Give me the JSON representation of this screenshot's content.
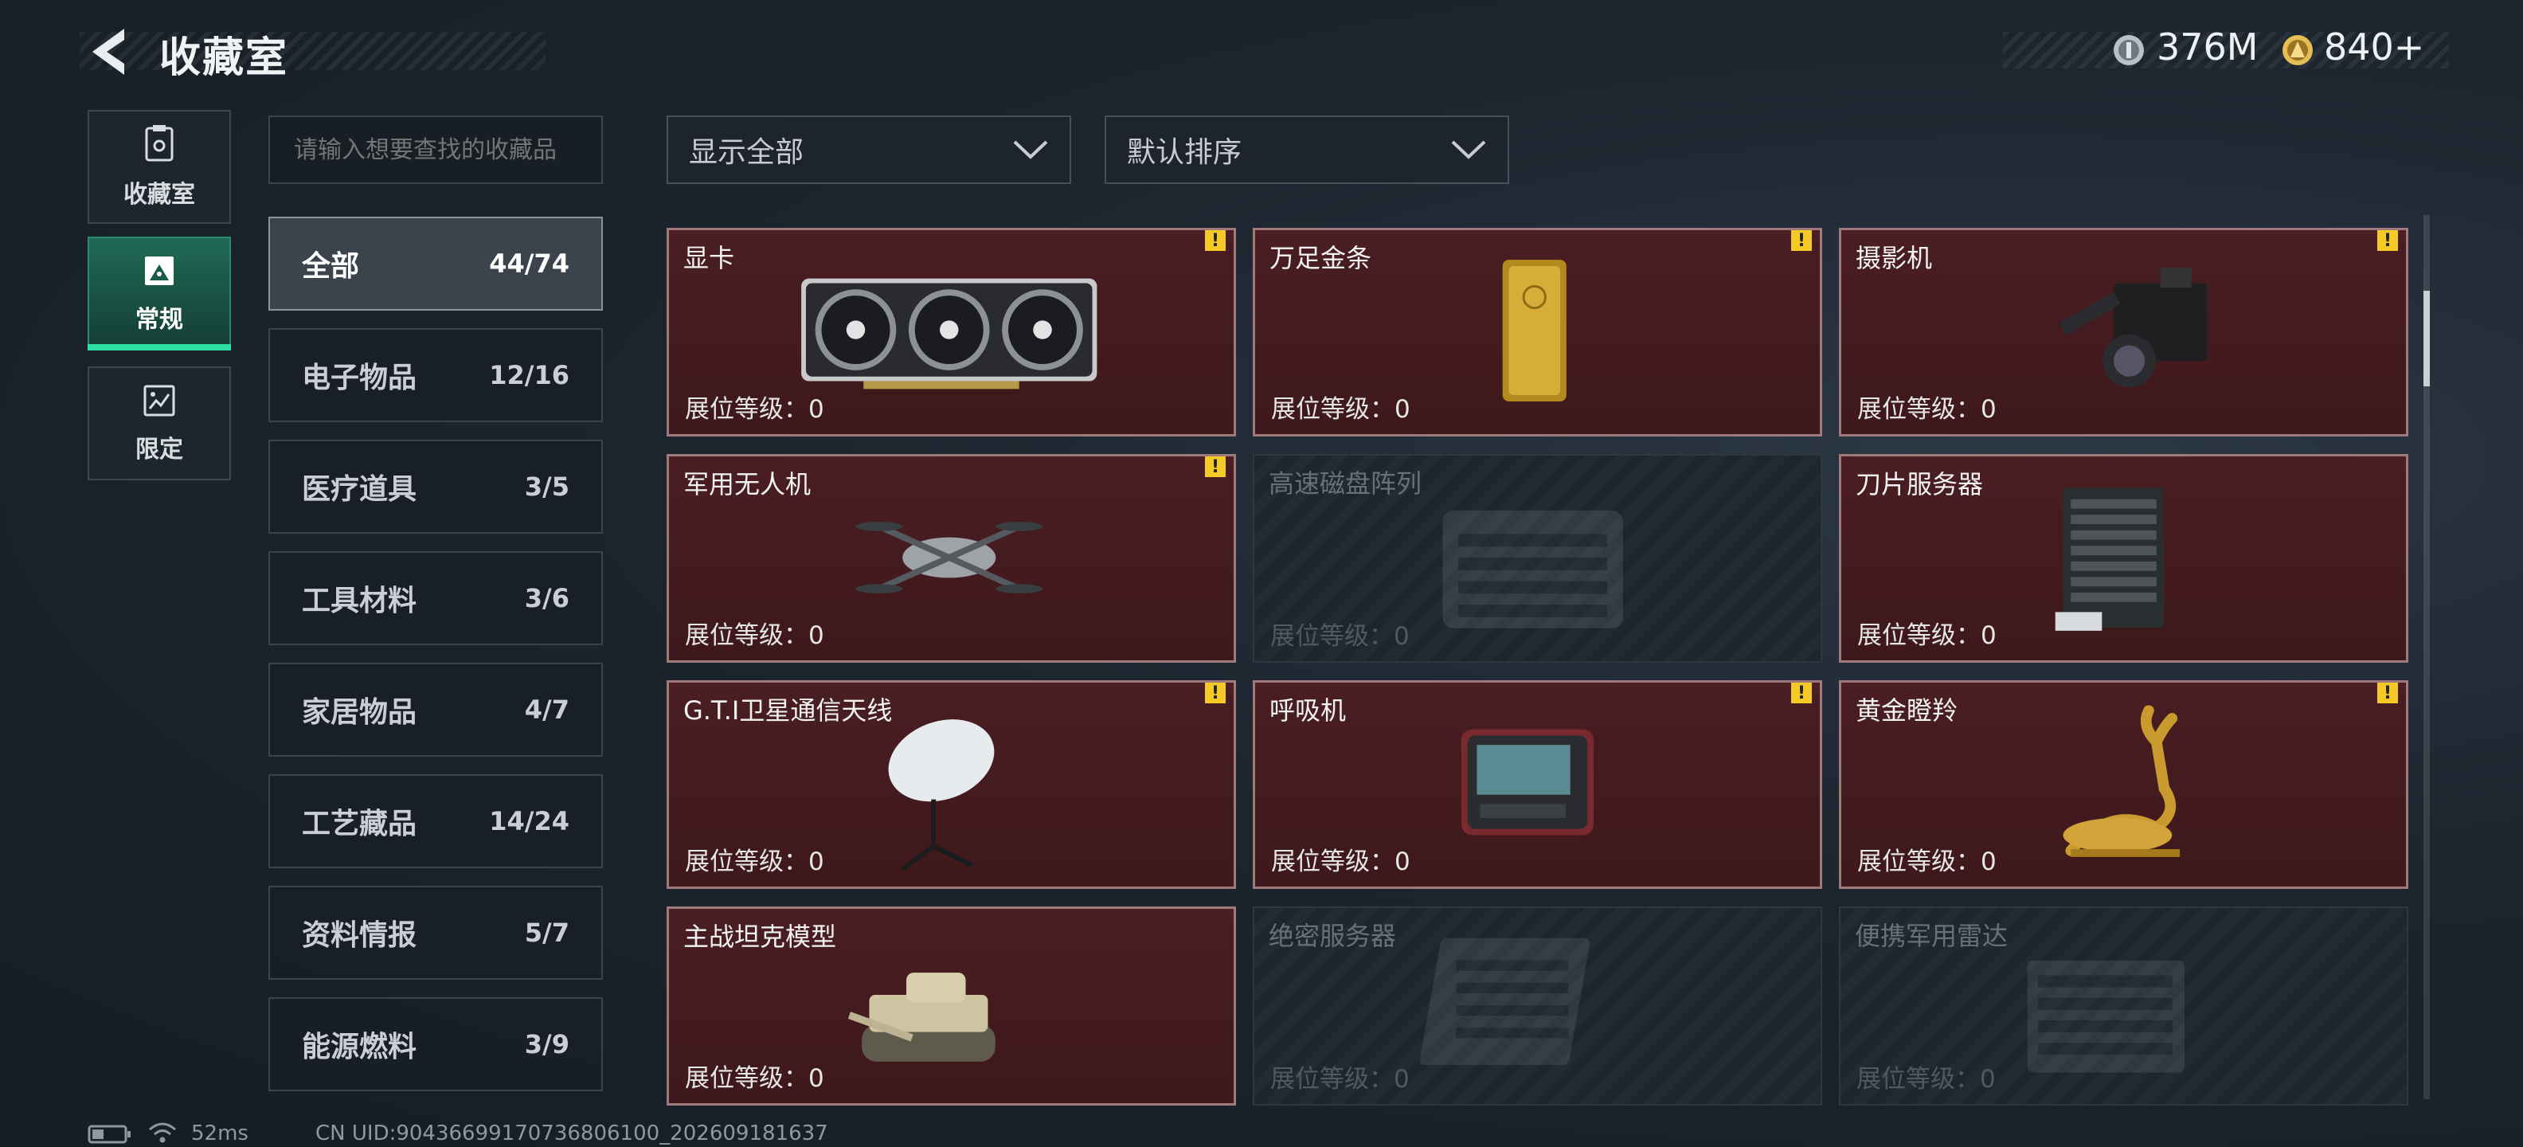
{
  "header": {
    "title": "收藏室",
    "currency": [
      {
        "icon": "silver-coin-icon",
        "value": "376M"
      },
      {
        "icon": "gold-coin-icon",
        "value": "840+"
      }
    ]
  },
  "nav": [
    {
      "label": "收藏室",
      "icon": "collection-room-icon",
      "active": false
    },
    {
      "label": "常规",
      "icon": "regular-items-icon",
      "active": true
    },
    {
      "label": "限定",
      "icon": "limited-items-icon",
      "active": false
    }
  ],
  "search": {
    "placeholder": "请输入想要查找的收藏品"
  },
  "categories": [
    {
      "name": "全部",
      "count": "44/74",
      "active": true
    },
    {
      "name": "电子物品",
      "count": "12/16",
      "active": false
    },
    {
      "name": "医疗道具",
      "count": "3/5",
      "active": false
    },
    {
      "name": "工具材料",
      "count": "3/6",
      "active": false
    },
    {
      "name": "家居物品",
      "count": "4/7",
      "active": false
    },
    {
      "name": "工艺藏品",
      "count": "14/24",
      "active": false
    },
    {
      "name": "资料情报",
      "count": "5/7",
      "active": false
    },
    {
      "name": "能源燃料",
      "count": "3/9",
      "active": false
    }
  ],
  "filters": {
    "show": "显示全部",
    "sort": "默认排序"
  },
  "items": [
    {
      "name": "显卡",
      "level": "展位等级：0",
      "warn": "!",
      "locked": false,
      "art": "graphics-card"
    },
    {
      "name": "万足金条",
      "level": "展位等级：0",
      "warn": "!",
      "locked": false,
      "art": "gold-bar"
    },
    {
      "name": "摄影机",
      "level": "展位等级：0",
      "warn": "!",
      "locked": false,
      "art": "camera"
    },
    {
      "name": "军用无人机",
      "level": "展位等级：0",
      "warn": "!",
      "locked": false,
      "art": "drone"
    },
    {
      "name": "高速磁盘阵列",
      "level": "展位等级：0",
      "warn": "",
      "locked": true,
      "art": "disk-array"
    },
    {
      "name": "刀片服务器",
      "level": "展位等级：0",
      "warn": "",
      "locked": false,
      "art": "blade-server"
    },
    {
      "name": "G.T.I卫星通信天线",
      "level": "展位等级：0",
      "warn": "!",
      "locked": false,
      "art": "satellite-antenna"
    },
    {
      "name": "呼吸机",
      "level": "展位等级：0",
      "warn": "!",
      "locked": false,
      "art": "ventilator"
    },
    {
      "name": "黄金瞪羚",
      "level": "展位等级：0",
      "warn": "!",
      "locked": false,
      "art": "golden-gazelle"
    },
    {
      "name": "主战坦克模型",
      "level": "展位等级：0",
      "warn": "",
      "locked": false,
      "art": "tank-model"
    },
    {
      "name": "绝密服务器",
      "level": "展位等级：0",
      "warn": "",
      "locked": true,
      "art": "secret-server"
    },
    {
      "name": "便携军用雷达",
      "level": "展位等级：0",
      "warn": "",
      "locked": true,
      "art": "portable-radar"
    }
  ],
  "footer": {
    "ping": "52ms",
    "uid": "CN UID:9043669917073680610​0_202609181637"
  }
}
